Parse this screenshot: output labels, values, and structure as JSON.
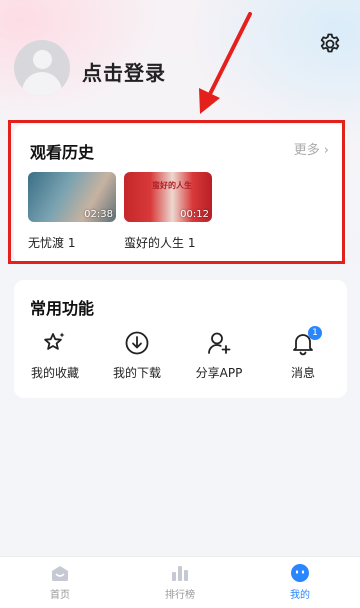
{
  "header": {
    "login_text": "点击登录"
  },
  "history": {
    "title": "观看历史",
    "more": "更多",
    "items": [
      {
        "duration": "02:38",
        "episode": "无忧渡 1"
      },
      {
        "duration": "00:12",
        "episode": "蛮好的人生 1",
        "poster_title": "蛮好的人生"
      }
    ]
  },
  "functions": {
    "title": "常用功能",
    "items": [
      {
        "label": "我的收藏",
        "icon": "star-sparkle-icon"
      },
      {
        "label": "我的下载",
        "icon": "download-icon"
      },
      {
        "label": "分享APP",
        "icon": "user-plus-icon"
      },
      {
        "label": "消息",
        "icon": "bell-icon",
        "badge": "1"
      }
    ]
  },
  "tabbar": {
    "items": [
      {
        "label": "首页",
        "icon": "home-icon"
      },
      {
        "label": "排行榜",
        "icon": "chart-bars-icon"
      },
      {
        "label": "我的",
        "icon": "smiley-icon",
        "active": true
      }
    ]
  },
  "colors": {
    "accent": "#2a86ff",
    "annotation": "#e3201c"
  }
}
